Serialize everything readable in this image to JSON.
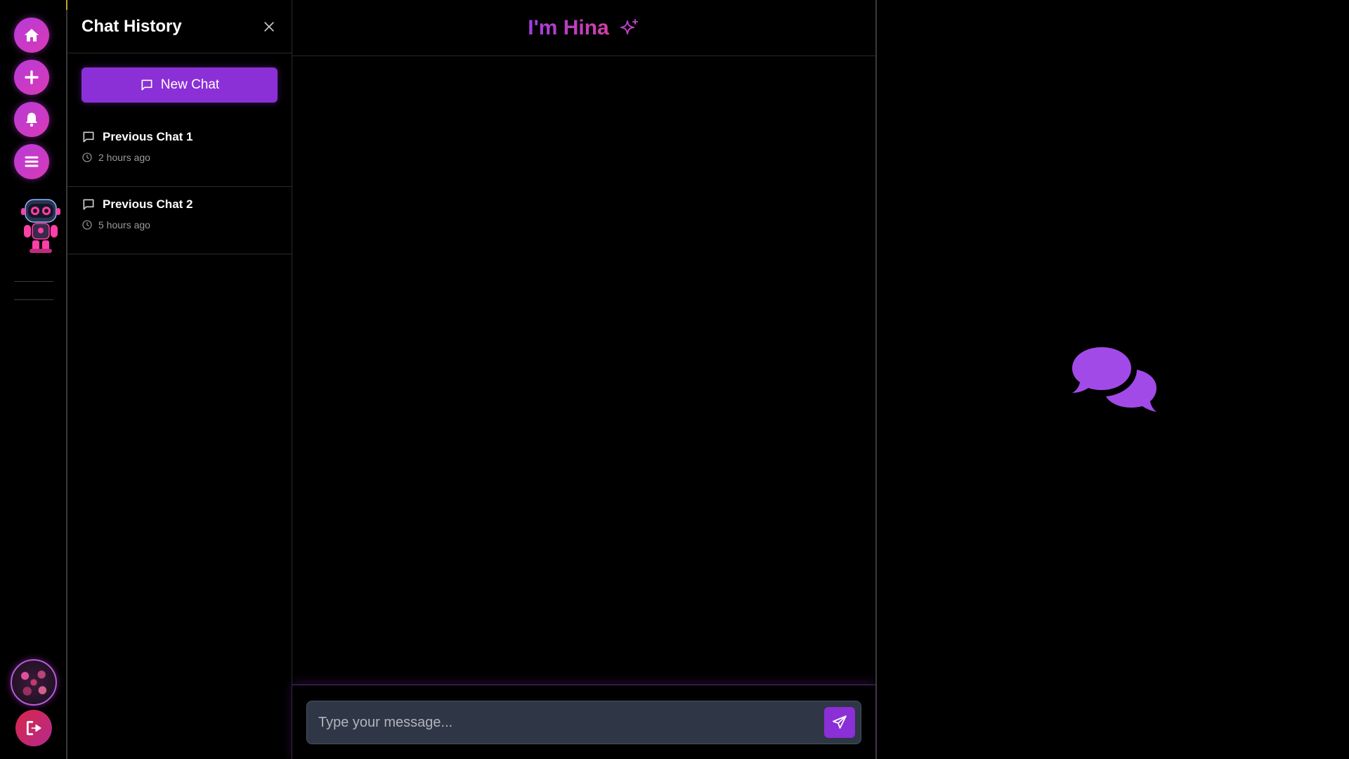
{
  "rail": {
    "buttons": [
      {
        "name": "home",
        "icon": "home-icon"
      },
      {
        "name": "add",
        "icon": "plus-icon"
      },
      {
        "name": "notifications",
        "icon": "bell-icon"
      },
      {
        "name": "menu",
        "icon": "menu-icon"
      }
    ],
    "mascot": "robot-mascot",
    "logout_icon": "logout-icon"
  },
  "history": {
    "title": "Chat History",
    "new_chat_label": "New Chat",
    "chats": [
      {
        "title": "Previous Chat 1",
        "time": "2 hours ago"
      },
      {
        "title": "Previous Chat 2",
        "time": "5 hours ago"
      }
    ]
  },
  "main": {
    "title": "I'm Hina",
    "input_placeholder": "Type your message...",
    "input_value": ""
  },
  "colors": {
    "accent": "#8b2fd6",
    "rail_gradient_start": "#b83ad8",
    "rail_gradient_end": "#d83ab6",
    "logout": "#d8264a",
    "bubbles": "#a24ae8"
  }
}
